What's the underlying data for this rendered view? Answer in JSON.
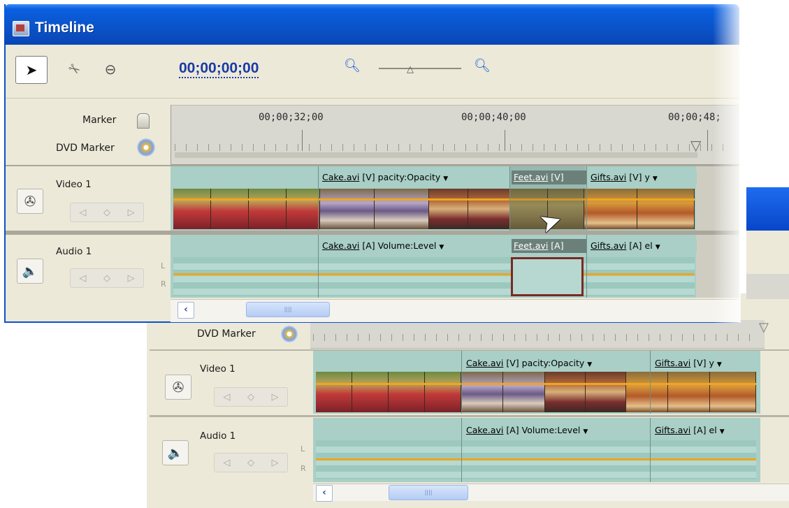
{
  "window": {
    "title": "Timeline"
  },
  "toolbar": {
    "timecode": "00;00;00;00"
  },
  "ruler": {
    "marker_label": "Marker",
    "dvd_marker_label": "DVD Marker",
    "timecodes": [
      "00;00;32;00",
      "00;00;40;00",
      "00;00;48;"
    ]
  },
  "front": {
    "video": {
      "name": "Video 1",
      "clips": [
        {
          "label_name": "Cake.avi",
          "label_suffix": " [V] ",
          "label_effect": "pacity:Opacity"
        },
        {
          "label_name": "Feet.avi",
          "label_suffix": " [V]",
          "label_effect": ""
        },
        {
          "label_name": "Gifts.avi",
          "label_suffix": " [V] ",
          "label_effect": "y"
        }
      ]
    },
    "audio": {
      "name": "Audio 1",
      "clips": [
        {
          "label_name": "Cake.avi",
          "label_suffix": " [A] ",
          "label_effect": "Volume:Level"
        },
        {
          "label_name": "Feet.avi",
          "label_suffix": " [A]",
          "label_effect": ""
        },
        {
          "label_name": "Gifts.avi",
          "label_suffix": " [A] ",
          "label_effect": "el"
        }
      ]
    }
  },
  "back": {
    "dvd_marker_label": "DVD Marker",
    "video": {
      "name": "Video 1",
      "clips": [
        {
          "label_name": "Cake.avi",
          "label_suffix": " [V] ",
          "label_effect": "pacity:Opacity"
        },
        {
          "label_name": "Gifts.avi",
          "label_suffix": " [V] ",
          "label_effect": "y"
        }
      ]
    },
    "audio": {
      "name": "Audio 1",
      "clips": [
        {
          "label_name": "Cake.avi",
          "label_suffix": " [A] ",
          "label_effect": "Volume:Level"
        },
        {
          "label_name": "Gifts.avi",
          "label_suffix": " [A] ",
          "label_effect": "el"
        }
      ]
    }
  },
  "channels": {
    "left": "L",
    "right": "R"
  },
  "icons": {
    "selection": "arrow-cursor-icon",
    "razor": "razor-icon",
    "zoom_tool": "zoom-tool-icon",
    "zoom_out": "zoom-out-icon",
    "zoom_in": "zoom-in-icon",
    "video_track": "film-reel-icon",
    "audio_track": "speaker-icon",
    "marker": "marker-icon",
    "dvd_marker": "dvd-marker-icon",
    "nav_prev": "prev-keyframe-icon",
    "nav_add": "add-keyframe-icon",
    "nav_next": "next-keyframe-icon",
    "scroll_left": "scroll-left-icon"
  },
  "colors": {
    "title_bar": "#0a53c8",
    "clip_teal": "#a9cfc6",
    "orange_line": "#f0a51e",
    "ruler_bg": "#d8d7d0",
    "panel_bg": "#ece9d8",
    "timecode_blue": "#1b3aa6"
  },
  "zoom_level": 0.4
}
